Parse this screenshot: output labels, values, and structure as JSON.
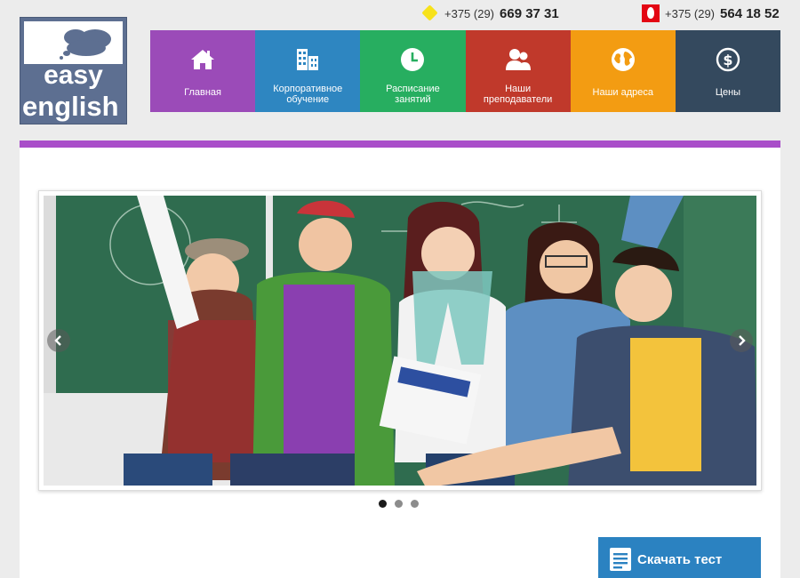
{
  "logo": {
    "word1": "easy",
    "word2": "english"
  },
  "phones": [
    {
      "operator_icon": "life-diamond-icon",
      "prefix": "+375 (29)",
      "number": "669 37 31",
      "color": "#f7e21b"
    },
    {
      "operator_icon": "mts-egg-icon",
      "prefix": "+375 (29)",
      "number": "564 18 52",
      "color": "#e30613"
    }
  ],
  "nav": {
    "items": [
      {
        "label": "Главная",
        "icon": "home-icon",
        "color": "#9b4bb8"
      },
      {
        "label": "Корпоративное\nобучение",
        "icon": "buildings-icon",
        "color": "#2e86c1"
      },
      {
        "label": "Расписание\nзанятий",
        "icon": "clock-icon",
        "color": "#27ae60"
      },
      {
        "label": "Наши\nпреподаватели",
        "icon": "teachers-icon",
        "color": "#c0392b"
      },
      {
        "label": "Наши адреса",
        "icon": "globe-icon",
        "color": "#f39c12"
      },
      {
        "label": "Цены",
        "icon": "dollar-icon",
        "color": "#34495e"
      }
    ]
  },
  "accent_color": "#a94ec9",
  "slider": {
    "slides": 3,
    "active_slide": 1,
    "image_alt_icon": "students-photo"
  },
  "download": {
    "label": "Скачать тест",
    "icon": "document-icon",
    "color": "#2b82c1"
  }
}
